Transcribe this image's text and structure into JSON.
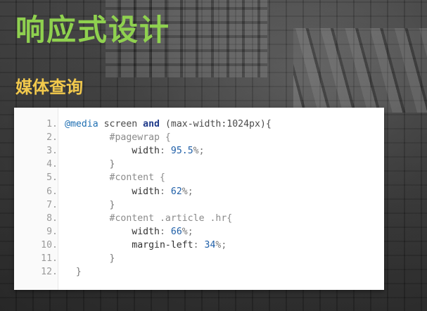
{
  "slide": {
    "title": "响应式设计",
    "subtitle": "媒体查询"
  },
  "colors": {
    "title": "#8fd14f",
    "subtitle": "#f2c94c",
    "panel": "#ffffff"
  },
  "code": {
    "lines": [
      {
        "n": "1.",
        "parts": [
          [
            "kw-at",
            "@media"
          ],
          [
            "plain",
            " screen "
          ],
          [
            "kw",
            "and"
          ],
          [
            "plain",
            " (max-width:1024px){"
          ]
        ]
      },
      {
        "n": "2.",
        "parts": [
          [
            "plain",
            "        "
          ],
          [
            "sel",
            "#pagewrap {"
          ]
        ]
      },
      {
        "n": "3.",
        "parts": [
          [
            "plain",
            "            "
          ],
          [
            "prop",
            "width"
          ],
          [
            "punc",
            ": "
          ],
          [
            "num",
            "95.5"
          ],
          [
            "punc",
            "%;"
          ]
        ]
      },
      {
        "n": "4.",
        "parts": [
          [
            "plain",
            "        "
          ],
          [
            "punc",
            "}"
          ]
        ]
      },
      {
        "n": "5.",
        "parts": [
          [
            "plain",
            "        "
          ],
          [
            "sel",
            "#content {"
          ]
        ]
      },
      {
        "n": "6.",
        "parts": [
          [
            "plain",
            "            "
          ],
          [
            "prop",
            "width"
          ],
          [
            "punc",
            ": "
          ],
          [
            "num",
            "62"
          ],
          [
            "punc",
            "%;"
          ]
        ]
      },
      {
        "n": "7.",
        "parts": [
          [
            "plain",
            "        "
          ],
          [
            "punc",
            "}"
          ]
        ]
      },
      {
        "n": "8.",
        "parts": [
          [
            "plain",
            "        "
          ],
          [
            "sel",
            "#content .article .hr{"
          ]
        ]
      },
      {
        "n": "9.",
        "parts": [
          [
            "plain",
            "            "
          ],
          [
            "prop",
            "width"
          ],
          [
            "punc",
            ": "
          ],
          [
            "num",
            "66"
          ],
          [
            "punc",
            "%;"
          ]
        ]
      },
      {
        "n": "10.",
        "parts": [
          [
            "plain",
            "            "
          ],
          [
            "prop",
            "margin-left"
          ],
          [
            "punc",
            ": "
          ],
          [
            "num",
            "34"
          ],
          [
            "punc",
            "%;"
          ]
        ]
      },
      {
        "n": "11.",
        "parts": [
          [
            "plain",
            "        "
          ],
          [
            "punc",
            "}"
          ]
        ]
      },
      {
        "n": "12.",
        "parts": [
          [
            "plain",
            "  "
          ],
          [
            "punc",
            "}"
          ]
        ]
      }
    ]
  }
}
